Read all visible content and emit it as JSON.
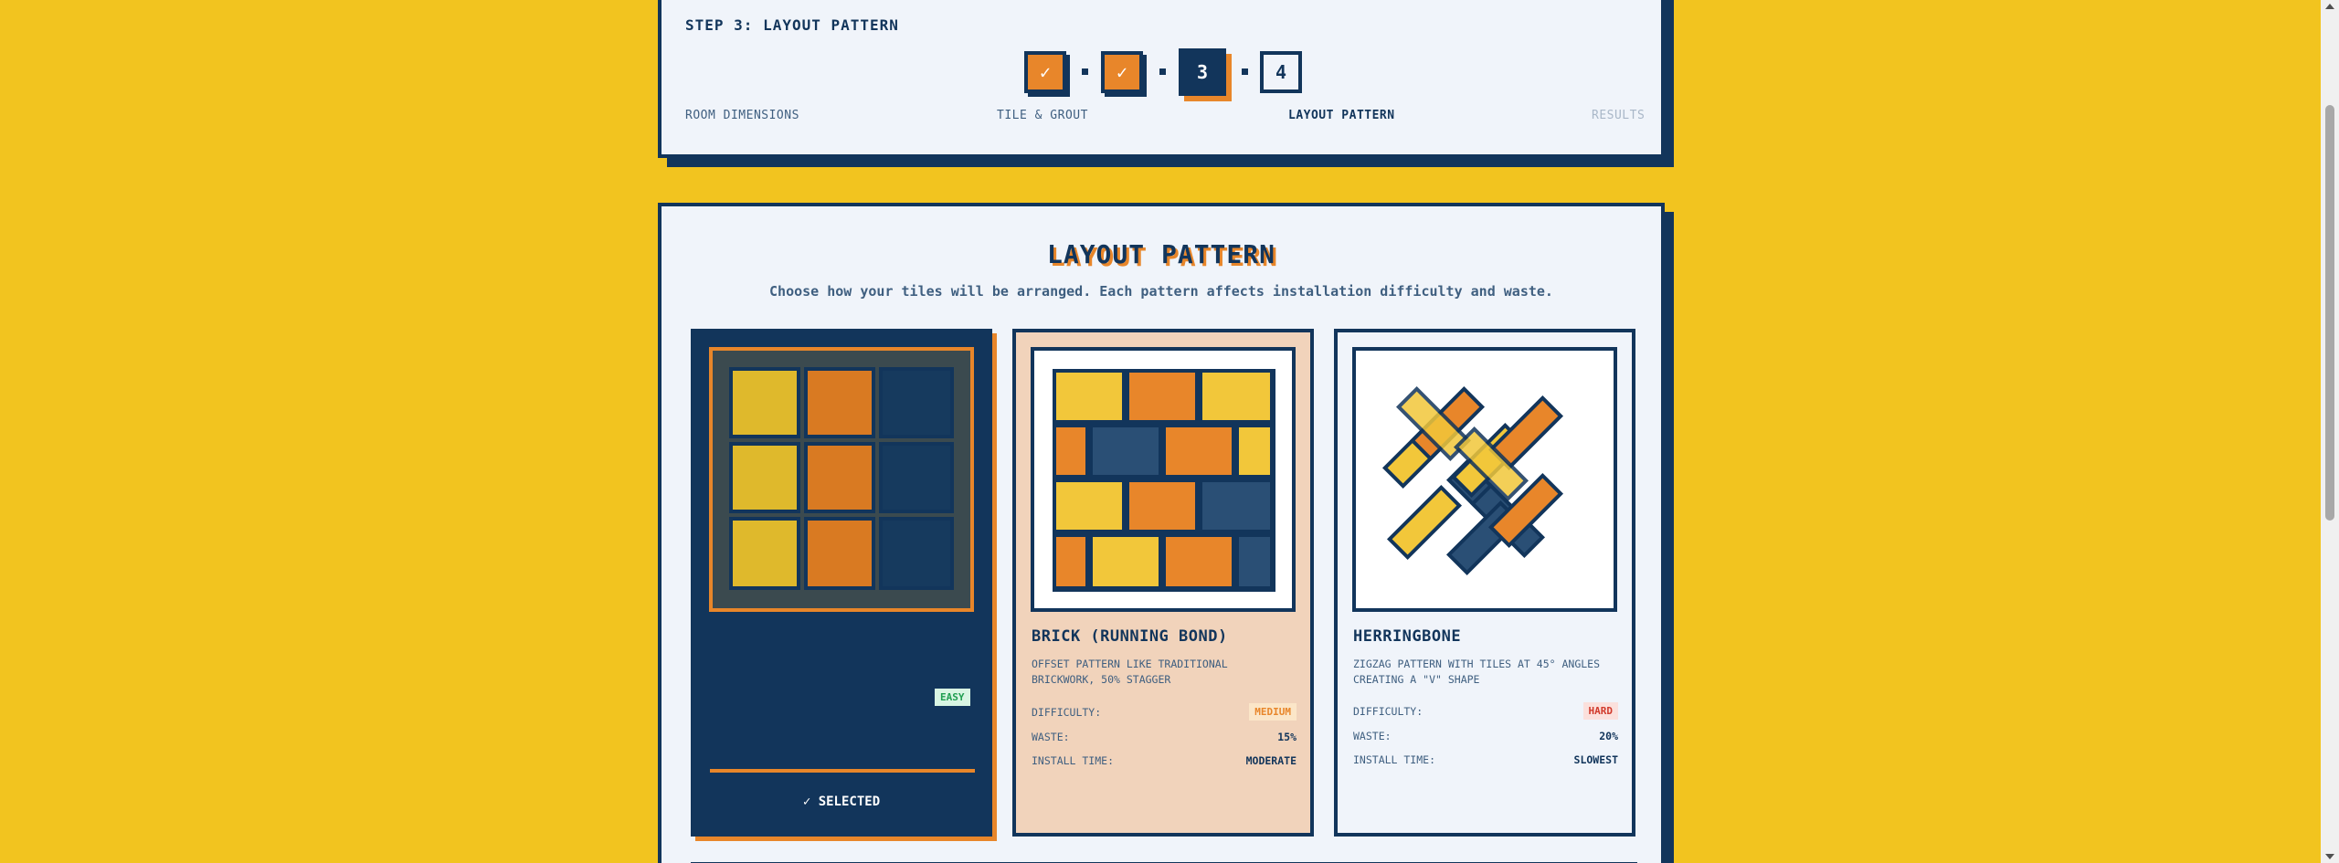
{
  "stepper": {
    "title": "STEP 3: LAYOUT PATTERN",
    "steps": [
      {
        "num": "✓",
        "label": "ROOM DIMENSIONS",
        "state": "done"
      },
      {
        "num": "✓",
        "label": "TILE & GROUT",
        "state": "done"
      },
      {
        "num": "3",
        "label": "LAYOUT PATTERN",
        "state": "current"
      },
      {
        "num": "4",
        "label": "RESULTS",
        "state": "todo"
      }
    ]
  },
  "main": {
    "title": "LAYOUT PATTERN",
    "subtitle": "Choose how your tiles will be arranged. Each pattern affects installation difficulty and waste."
  },
  "patterns": [
    {
      "id": "grid",
      "badge": "EASY",
      "selected_label": "✓ SELECTED",
      "selected": true
    },
    {
      "id": "brick",
      "name": "BRICK (RUNNING BOND)",
      "desc": "OFFSET PATTERN LIKE TRADITIONAL BRICKWORK, 50% STAGGER",
      "difficulty_label": "DIFFICULTY:",
      "difficulty": "MEDIUM",
      "waste_label": "WASTE:",
      "waste": "15%",
      "time_label": "INSTALL TIME:",
      "time": "MODERATE"
    },
    {
      "id": "herringbone",
      "name": "HERRINGBONE",
      "desc": "ZIGZAG PATTERN WITH TILES AT 45° ANGLES CREATING A \"V\" SHAPE",
      "difficulty_label": "DIFFICULTY:",
      "difficulty": "HARD",
      "waste_label": "WASTE:",
      "waste": "20%",
      "time_label": "INSTALL TIME:",
      "time": "SLOWEST"
    }
  ],
  "colors": {
    "background": "#f2c41f",
    "navy": "#12355b",
    "orange": "#e8862a",
    "yellow": "#f2c73a",
    "card": "#f0f4fa"
  }
}
